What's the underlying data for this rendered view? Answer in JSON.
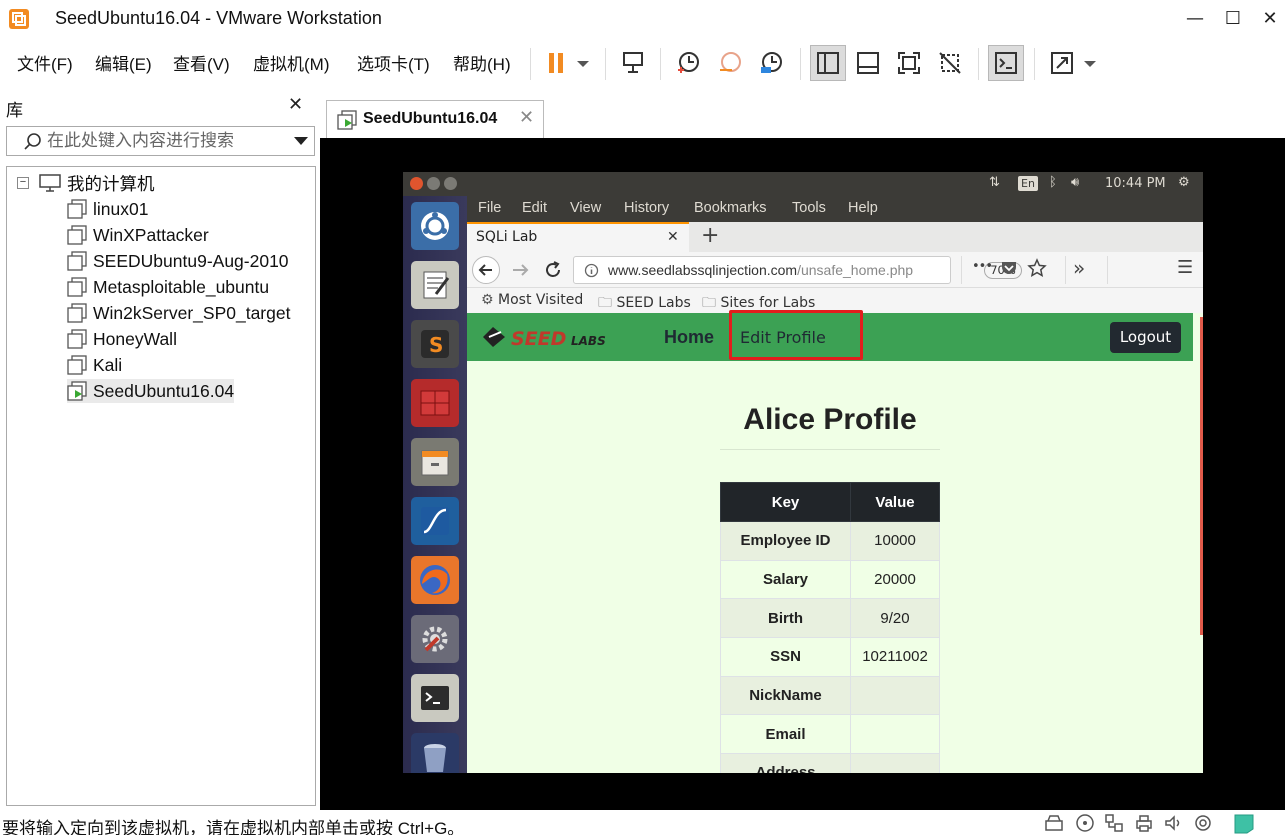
{
  "window": {
    "title": "SeedUbuntu16.04 - VMware Workstation",
    "minimize": "—",
    "maximize": "☐",
    "close": "✕"
  },
  "menu": {
    "file": "文件(F)",
    "edit": "编辑(E)",
    "view": "查看(V)",
    "vm": "虚拟机(M)",
    "tabs": "选项卡(T)",
    "help": "帮助(H)"
  },
  "library": {
    "title": "库",
    "close": "✕",
    "search_placeholder": "在此处键入内容进行搜索",
    "root": "我的计算机",
    "vms": [
      "linux01",
      "WinXPattacker",
      "SEEDUbuntu9-Aug-2010",
      "Metasploitable_ubuntu",
      "Win2kServer_SP0_target",
      "HoneyWall",
      "Kali",
      "SeedUbuntu16.04"
    ]
  },
  "vm_tab": {
    "label": "SeedUbuntu16.04",
    "close": "✕"
  },
  "ubuntu": {
    "time": "10:44 PM",
    "lang": "En"
  },
  "firefox": {
    "menu": [
      "File",
      "Edit",
      "View",
      "History",
      "Bookmarks",
      "Tools",
      "Help"
    ],
    "tab_label": "SQLi Lab",
    "tab_close": "✕",
    "new_tab": "+",
    "url_domain": "www.seedlabssqlinjection.com",
    "url_path": "/unsafe_home.php",
    "zoom": "70%",
    "more": "•••",
    "overflow": "»",
    "hamburger": "☰",
    "bookmarks": [
      "Most Visited",
      "SEED Labs",
      "Sites for Labs"
    ]
  },
  "page": {
    "nav_home": "Home",
    "nav_edit_profile": "Edit Profile",
    "logout": "Logout",
    "profile_title": "Alice Profile",
    "table_headers": [
      "Key",
      "Value"
    ],
    "rows": [
      {
        "key": "Employee ID",
        "value": "10000"
      },
      {
        "key": "Salary",
        "value": "20000"
      },
      {
        "key": "Birth",
        "value": "9/20"
      },
      {
        "key": "SSN",
        "value": "10211002"
      },
      {
        "key": "NickName",
        "value": ""
      },
      {
        "key": "Email",
        "value": ""
      },
      {
        "key": "Address",
        "value": ""
      }
    ]
  },
  "status": {
    "text": "要将输入定向到该虚拟机，请在虚拟机内部单击或按 Ctrl+G。"
  },
  "colors": {
    "accent_orange": "#f28b22",
    "seed_green": "#3ca154",
    "page_bg": "#f0ffe6",
    "highlight_red": "#e21d1d"
  }
}
